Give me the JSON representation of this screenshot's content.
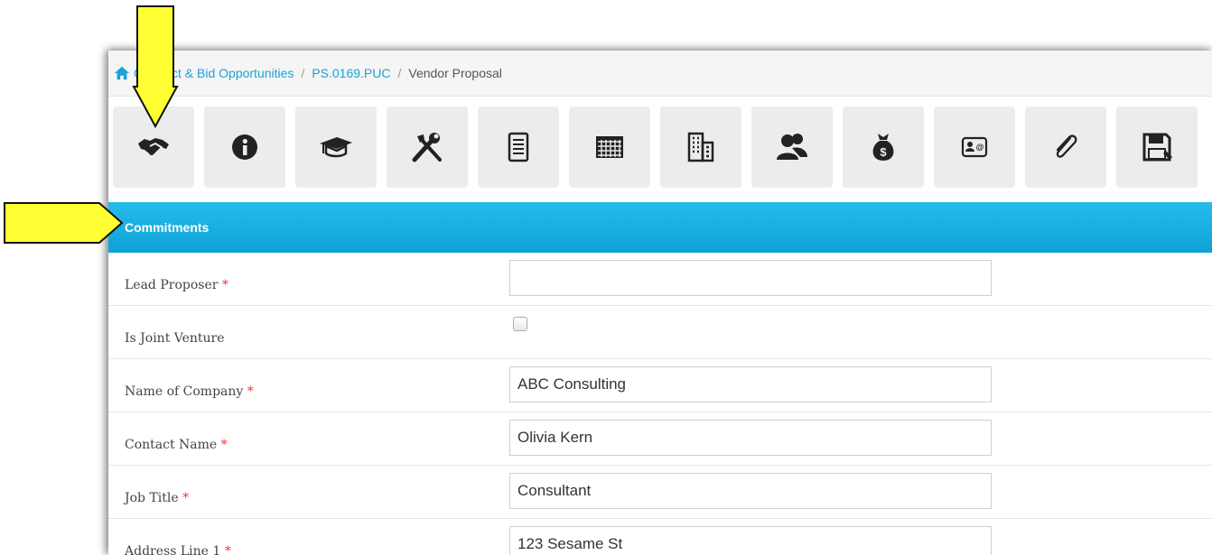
{
  "breadcrumb": {
    "items": [
      "Contract & Bid Opportunities",
      "PS.0169.PUC"
    ],
    "separator": "/",
    "current": "Vendor Proposal"
  },
  "toolbar": {
    "icons": [
      "handshake-icon",
      "info-icon",
      "graduation-cap-icon",
      "tools-icon",
      "document-list-icon",
      "calendar-grid-icon",
      "buildings-icon",
      "users-icon",
      "money-bag-icon",
      "contact-card-icon",
      "paperclip-icon",
      "save-icon"
    ]
  },
  "section": {
    "title": "Commitments"
  },
  "form": {
    "fields": [
      {
        "label": "Lead Proposer",
        "required": "*",
        "value": ""
      },
      {
        "label": "Is Joint Venture",
        "required": "",
        "value": ""
      },
      {
        "label": "Name of Company",
        "required": "*",
        "value": "ABC Consulting"
      },
      {
        "label": "Contact Name",
        "required": "*",
        "value": "Olivia Kern"
      },
      {
        "label": "Job Title",
        "required": "*",
        "value": "Consultant"
      },
      {
        "label": "Address Line 1",
        "required": "*",
        "value": "123 Sesame St"
      }
    ]
  },
  "colors": {
    "accent": "#1aa3d9",
    "header": "#14aee0",
    "arrow": "#ffff33"
  }
}
